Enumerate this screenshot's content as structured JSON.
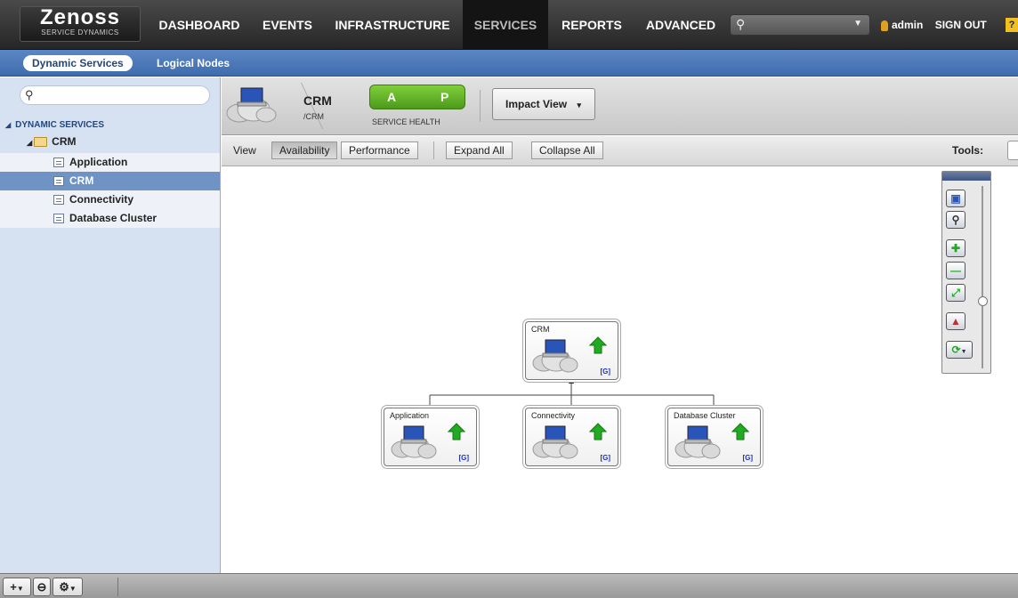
{
  "brand": {
    "name": "Zenoss",
    "tagline": "SERVICE DYNAMICS"
  },
  "nav": {
    "items": [
      {
        "label": "DASHBOARD",
        "active": false
      },
      {
        "label": "EVENTS",
        "active": false
      },
      {
        "label": "INFRASTRUCTURE",
        "active": false
      },
      {
        "label": "SERVICES",
        "active": true
      },
      {
        "label": "REPORTS",
        "active": false
      },
      {
        "label": "ADVANCED",
        "active": false
      }
    ],
    "search_placeholder": "",
    "user": "admin",
    "signout": "SIGN OUT",
    "help": "?"
  },
  "subnav": {
    "tabs": [
      "Dynamic Services",
      "Logical Nodes"
    ],
    "active": "Dynamic Services"
  },
  "tree": {
    "root": "DYNAMIC SERVICES",
    "folder": "CRM",
    "items": [
      "Application",
      "CRM",
      "Connectivity",
      "Database Cluster"
    ],
    "selected": "CRM"
  },
  "service": {
    "name": "CRM",
    "path": "/CRM",
    "health_a": "A",
    "health_p": "P",
    "health_label": "SERVICE HEALTH",
    "view_button": "Impact View",
    "view_caret": "▾"
  },
  "toolbar": {
    "view_label": "View",
    "availability": "Availability",
    "performance": "Performance",
    "expand_all": "Expand All",
    "collapse_all": "Collapse All",
    "tools_label": "Tools:"
  },
  "graph": {
    "root": {
      "title": "CRM",
      "tag": "[G]"
    },
    "children": [
      {
        "title": "Application",
        "tag": "[G]"
      },
      {
        "title": "Connectivity",
        "tag": "[G]"
      },
      {
        "title": "Database Cluster",
        "tag": "[G]"
      }
    ]
  },
  "colors": {
    "accent": "#4f7bbf",
    "health_green": "#5aaa22",
    "status_up": "#22aa22"
  }
}
